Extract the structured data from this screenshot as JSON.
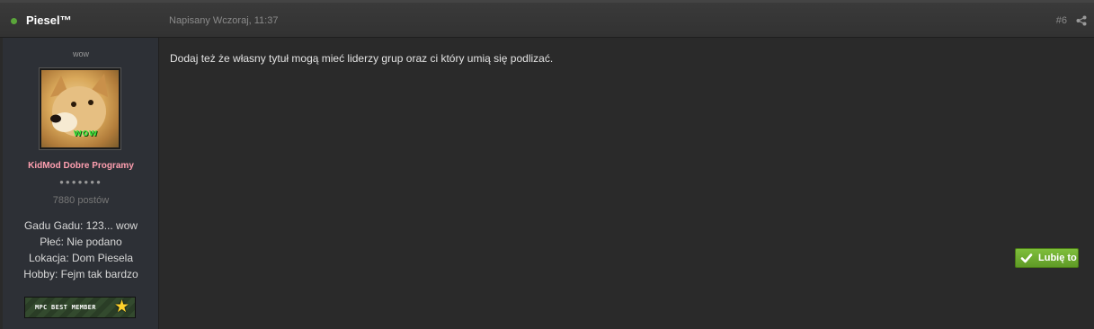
{
  "post": {
    "author": "Piesel™",
    "posted": "Napisany Wczoraj, 11:37",
    "number": "#6",
    "content": "Dodaj też że własny tytuł mogą mieć liderzy grup oraz ci który umią się podlizać."
  },
  "profile": {
    "title": "wow",
    "avatar_caption": "wow",
    "group": "KidMod Dobre Programy",
    "pips": "●●●●●●●",
    "posts": "7880 postów",
    "fields": [
      "Gadu Gadu: 123... wow",
      "Płeć: Nie podano",
      "Lokacja: Dom Piesela",
      "Hobby: Fejm tak bardzo"
    ],
    "badge": "MPC BEST MEMBER"
  },
  "actions": {
    "like": "Lubię to"
  },
  "colors": {
    "online": "#5aa53a",
    "group": "#ff9fb0",
    "like_button": "#6aaa2e"
  },
  "icons": {
    "online": "online-dot-icon",
    "share": "share-icon",
    "like": "check-icon",
    "badge": "star-icon"
  }
}
